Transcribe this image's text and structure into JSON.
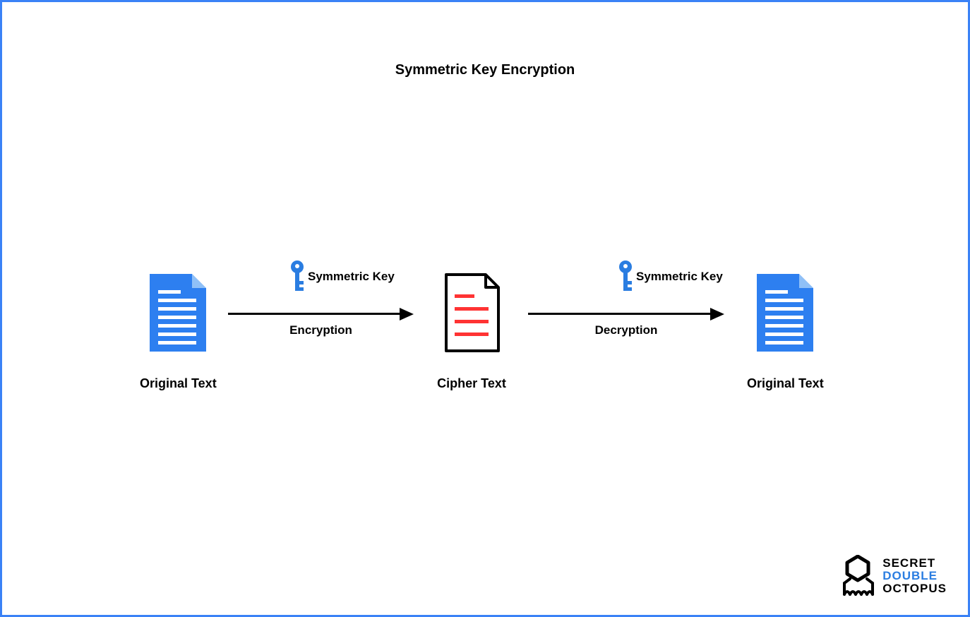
{
  "title": "Symmetric Key Encryption",
  "nodes": {
    "original_left": "Original Text",
    "cipher": "Cipher Text",
    "original_right": "Original Text"
  },
  "arrows": {
    "encrypt": "Encryption",
    "decrypt": "Decryption"
  },
  "keys": {
    "left": "Symmetric Key",
    "right": "Symmetric Key"
  },
  "logo": {
    "line1": "SECRET",
    "line2": "DOUBLE",
    "line3": "OCTOPUS"
  },
  "colors": {
    "accent_blue": "#2a7de1",
    "doc_blue": "#2d7ff0",
    "cipher_red": "#ff3333",
    "border_blue": "#3b82f6"
  }
}
